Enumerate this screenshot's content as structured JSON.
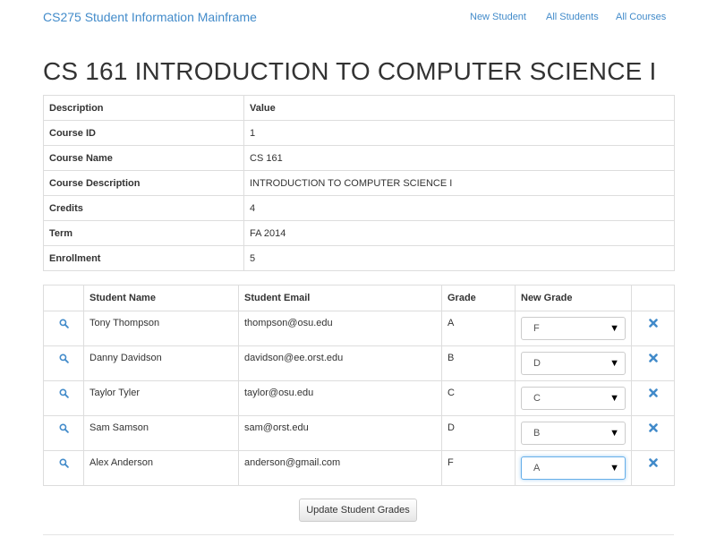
{
  "navbar": {
    "brand": "CS275 Student Information Mainframe",
    "links": [
      {
        "label": "New Student"
      },
      {
        "label": "All Students"
      },
      {
        "label": "All Courses"
      }
    ]
  },
  "page_title": "CS 161 INTRODUCTION TO COMPUTER SCIENCE I",
  "course_info": {
    "headers": [
      "Description",
      "Value"
    ],
    "rows": [
      {
        "key": "Course ID",
        "value": "1"
      },
      {
        "key": "Course Name",
        "value": "CS 161"
      },
      {
        "key": "Course Description",
        "value": "INTRODUCTION TO COMPUTER SCIENCE I"
      },
      {
        "key": "Credits",
        "value": "4"
      },
      {
        "key": "Term",
        "value": "FA 2014"
      },
      {
        "key": "Enrollment",
        "value": "5"
      }
    ]
  },
  "students": {
    "headers": [
      "",
      "Student Name",
      "Student Email",
      "Grade",
      "New Grade",
      ""
    ],
    "rows": [
      {
        "name": "Tony Thompson",
        "email": "thompson@osu.edu",
        "grade": "A",
        "new_grade": "F"
      },
      {
        "name": "Danny Davidson",
        "email": "davidson@ee.orst.edu",
        "grade": "B",
        "new_grade": "D"
      },
      {
        "name": "Taylor Tyler",
        "email": "taylor@osu.edu",
        "grade": "C",
        "new_grade": "C"
      },
      {
        "name": "Sam Samson",
        "email": "sam@orst.edu",
        "grade": "D",
        "new_grade": "B"
      },
      {
        "name": "Alex Anderson",
        "email": "anderson@gmail.com",
        "grade": "F",
        "new_grade": "A"
      }
    ]
  },
  "update_button": "Update Student Grades",
  "icons": {
    "view": "search-icon",
    "remove": "remove-x-icon",
    "dropdown": "caret-down-icon"
  },
  "colors": {
    "link": "#428bca",
    "border": "#dddddd",
    "focus": "#66afe9"
  }
}
